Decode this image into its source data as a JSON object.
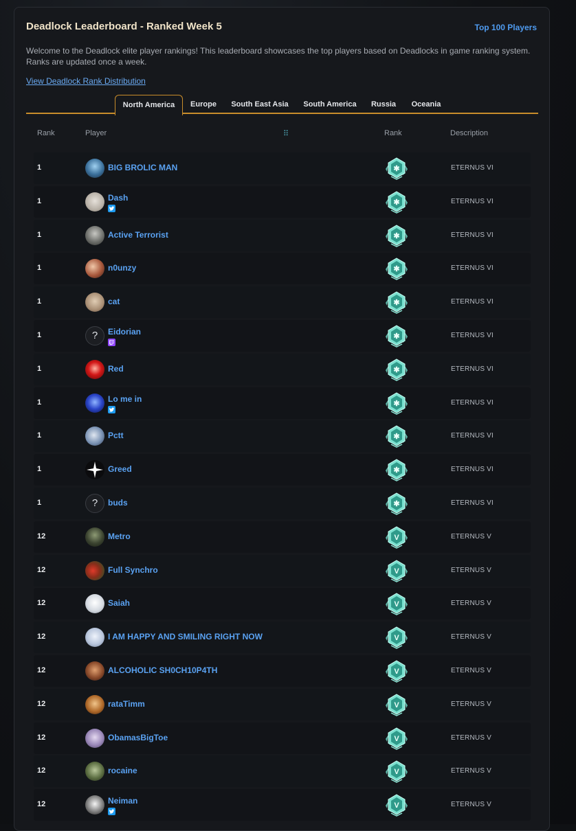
{
  "header": {
    "title": "Deadlock Leaderboard - Ranked Week 5",
    "top_link": "Top 100 Players",
    "intro": "Welcome to the Deadlock elite player rankings! This leaderboard showcases the top players based on Deadlocks in game ranking system. Ranks are updated once a week.",
    "distribution_link": "View Deadlock Rank Distribution"
  },
  "tabs": [
    "North America",
    "Europe",
    "South East Asia",
    "South America",
    "Russia",
    "Oceania"
  ],
  "active_tab": "North America",
  "columns": {
    "rank": "Rank",
    "player": "Player",
    "tier": "Rank",
    "description": "Description"
  },
  "badge_symbols": {
    "ETERNUS VI": "✱",
    "ETERNUS V": "V"
  },
  "colors": {
    "accent": "#c98d2b",
    "link": "#5aa2f2",
    "badge": "#6fd6c6"
  },
  "rows": [
    {
      "rank": "1",
      "player": "BIG BROLIC MAN",
      "description": "ETERNUS VI",
      "social": null,
      "avatar": "hero-blue"
    },
    {
      "rank": "1",
      "player": "Dash",
      "description": "ETERNUS VI",
      "social": "twitter-icon",
      "avatar": "cat-white"
    },
    {
      "rank": "1",
      "player": "Active Terrorist",
      "description": "ETERNUS VI",
      "social": null,
      "avatar": "man-portrait"
    },
    {
      "rank": "1",
      "player": "n0unzy",
      "description": "ETERNUS VI",
      "social": null,
      "avatar": "girl-anime"
    },
    {
      "rank": "1",
      "player": "cat",
      "description": "ETERNUS VI",
      "social": null,
      "avatar": "cat-tan"
    },
    {
      "rank": "1",
      "player": "Eidorian",
      "description": "ETERNUS VI",
      "social": "twitch-icon",
      "avatar": "unknown"
    },
    {
      "rank": "1",
      "player": "Red",
      "description": "ETERNUS VI",
      "social": null,
      "avatar": "red-face"
    },
    {
      "rank": "1",
      "player": "Lo me in",
      "description": "ETERNUS VI",
      "social": "twitter-icon",
      "avatar": "blue-robot"
    },
    {
      "rank": "1",
      "player": "Pctt",
      "description": "ETERNUS VI",
      "social": null,
      "avatar": "grey-bird"
    },
    {
      "rank": "1",
      "player": "Greed",
      "description": "ETERNUS VI",
      "social": null,
      "avatar": "star-black"
    },
    {
      "rank": "1",
      "player": "buds",
      "description": "ETERNUS VI",
      "social": null,
      "avatar": "unknown"
    },
    {
      "rank": "12",
      "player": "Metro",
      "description": "ETERNUS V",
      "social": null,
      "avatar": "dark-figure"
    },
    {
      "rank": "12",
      "player": "Full Synchro",
      "description": "ETERNUS V",
      "social": null,
      "avatar": "red-green-art"
    },
    {
      "rank": "12",
      "player": "Saiah",
      "description": "ETERNUS V",
      "social": null,
      "avatar": "white-anime"
    },
    {
      "rank": "12",
      "player": "I AM HAPPY AND SMILING RIGHT NOW",
      "description": "ETERNUS V",
      "social": null,
      "avatar": "pale-anime"
    },
    {
      "rank": "12",
      "player": "ALCOHOLIC SH0CH10P4TH",
      "description": "ETERNUS V",
      "social": null,
      "avatar": "brown-face"
    },
    {
      "rank": "12",
      "player": "rataTimm",
      "description": "ETERNUS V",
      "social": null,
      "avatar": "rat-orange"
    },
    {
      "rank": "12",
      "player": "ObamasBigToe",
      "description": "ETERNUS V",
      "social": null,
      "avatar": "purple-face"
    },
    {
      "rank": "12",
      "player": "rocaine",
      "description": "ETERNUS V",
      "social": null,
      "avatar": "green-figure"
    },
    {
      "rank": "12",
      "player": "Neiman",
      "description": "ETERNUS V",
      "social": "twitter-icon",
      "avatar": "bw-portrait"
    }
  ]
}
